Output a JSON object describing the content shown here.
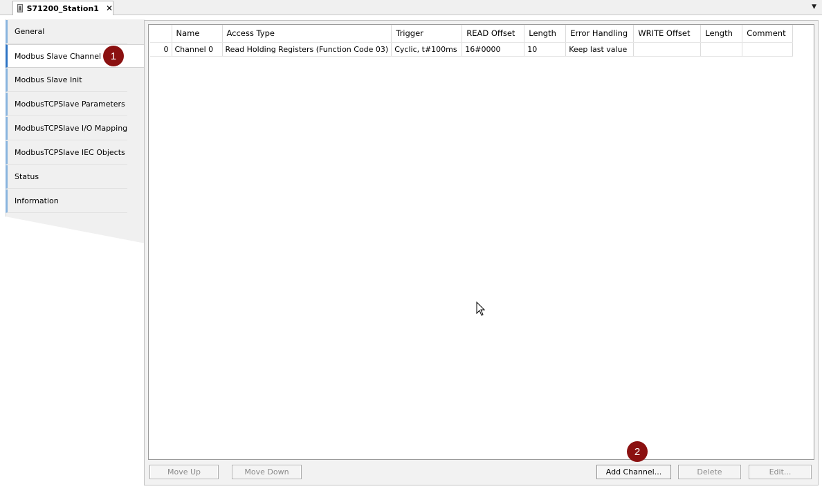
{
  "editor": {
    "tab_title": "S71200_Station1",
    "close_glyph": "✕",
    "menu_glyph": "▼"
  },
  "nav": {
    "items": [
      {
        "label": "General",
        "active": false
      },
      {
        "label": "Modbus Slave Channel",
        "active": true
      },
      {
        "label": "Modbus Slave Init",
        "active": false
      },
      {
        "label": "ModbusTCPSlave Parameters",
        "active": false
      },
      {
        "label": "ModbusTCPSlave I/O Mapping",
        "active": false
      },
      {
        "label": "ModbusTCPSlave IEC Objects",
        "active": false
      },
      {
        "label": "Status",
        "active": false
      },
      {
        "label": "Information",
        "active": false
      }
    ]
  },
  "badges": {
    "first": "1",
    "second": "2"
  },
  "table": {
    "columns": [
      "",
      "Name",
      "Access Type",
      "Trigger",
      "READ Offset",
      "Length",
      "Error Handling",
      "WRITE Offset",
      "Length",
      "Comment"
    ],
    "rows": [
      [
        "0",
        "Channel 0",
        "Read Holding Registers (Function Code 03)",
        "Cyclic, t#100ms",
        "16#0000",
        "10",
        "Keep last value",
        "",
        "",
        ""
      ]
    ]
  },
  "buttons": {
    "move_up": "Move Up",
    "move_down": "Move Down",
    "add_channel": "Add Channel...",
    "delete": "Delete",
    "edit": "Edit..."
  },
  "colors": {
    "badge": "#8b1111",
    "nav_accent": "#89b4de",
    "nav_active_accent": "#2d74c4"
  }
}
